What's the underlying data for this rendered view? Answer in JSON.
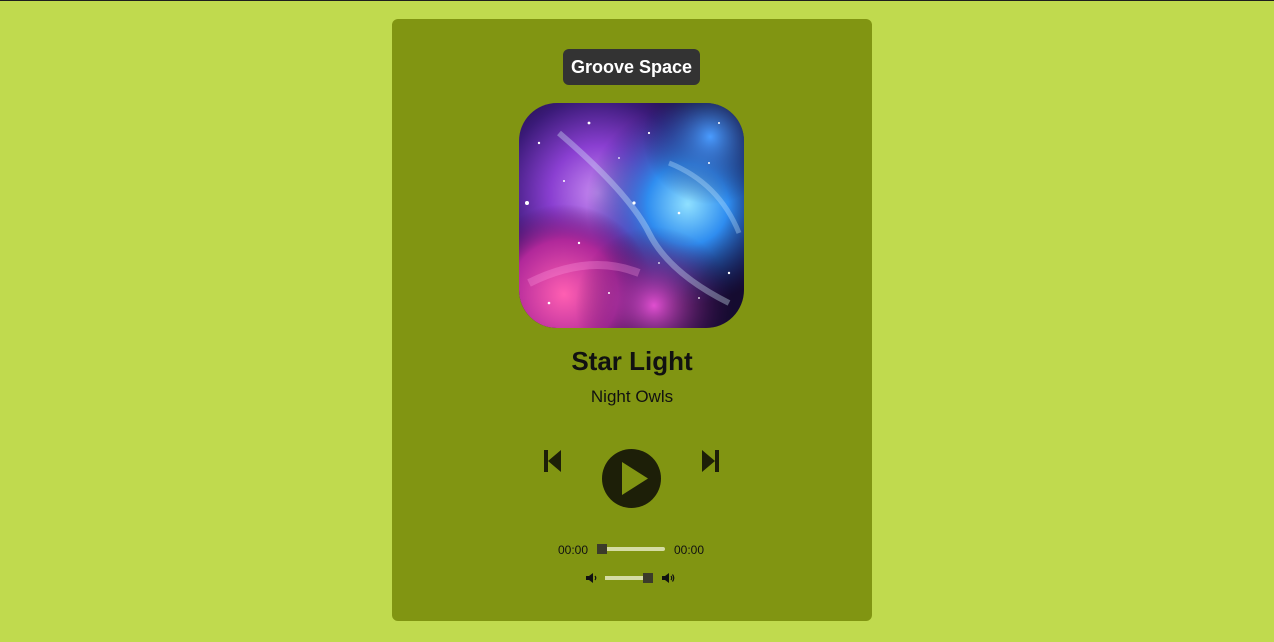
{
  "app": {
    "brand": "Groove Space"
  },
  "track": {
    "title": "Star Light",
    "artist": "Night Owls",
    "album_art_icon": "galaxy-artwork"
  },
  "controls": {
    "prev_icon": "skip-previous-icon",
    "play_icon": "play-icon",
    "next_icon": "skip-next-icon"
  },
  "progress": {
    "current_time": "00:00",
    "duration": "00:00",
    "value": 0
  },
  "volume": {
    "low_icon": "volume-low-icon",
    "high_icon": "volume-high-icon",
    "value": 0.9
  },
  "colors": {
    "background": "#c0da4e",
    "card": "#819512",
    "brand_bg": "#333333",
    "play_button": "#1d1f08"
  }
}
